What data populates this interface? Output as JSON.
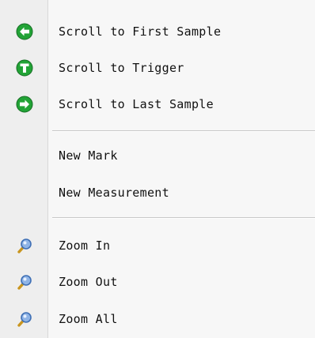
{
  "menu": {
    "items": [
      {
        "label": "Scroll to First Sample",
        "icon": "arrow-left-green-icon"
      },
      {
        "label": "Scroll to Trigger",
        "icon": "trigger-t-green-icon"
      },
      {
        "label": "Scroll to Last Sample",
        "icon": "arrow-right-green-icon"
      },
      {
        "label": "New Mark"
      },
      {
        "label": "New Measurement"
      },
      {
        "label": "Zoom In",
        "icon": "magnifier-icon"
      },
      {
        "label": "Zoom Out",
        "icon": "magnifier-icon"
      },
      {
        "label": "Zoom All",
        "icon": "magnifier-icon"
      }
    ]
  },
  "colors": {
    "green_icon": "#22a336",
    "magnifier_lens": "#8fb4e6",
    "magnifier_handle": "#c9951e"
  }
}
